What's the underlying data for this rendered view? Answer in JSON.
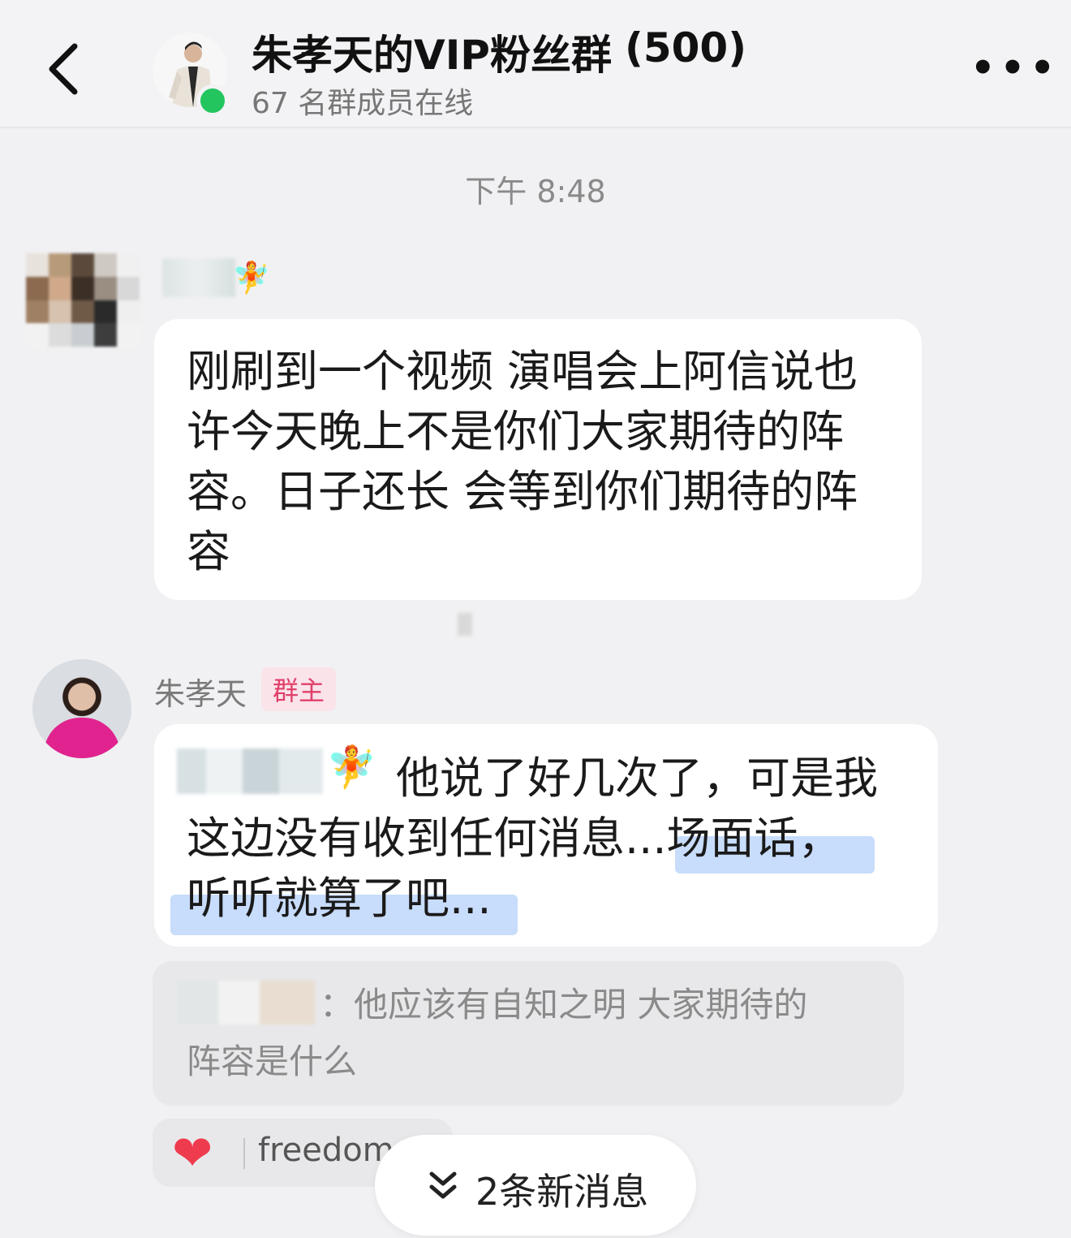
{
  "header": {
    "group_name": "朱孝天的VIP粉丝群",
    "member_count": "(500)",
    "online_status": "67 名群成员在线",
    "more_label": "•••"
  },
  "chat": {
    "timestamp": "下午 8:48",
    "messages": [
      {
        "sender_emoji": "🧚",
        "lines": [
          "刚刷到一个视频 演唱会上阿信说也",
          "许今天晚上不是你们大家期待的阵",
          "容。日子还长 会等到你们期待的阵",
          "容"
        ]
      },
      {
        "sender": "朱孝天",
        "badge": "群主",
        "mention_emoji": "🧚",
        "lines": [
          "他说了好几次了，可是我",
          "这边没有收到任何消息...场面话，",
          "听听就算了吧..."
        ],
        "quote": {
          "separator": "：",
          "lines": [
            "他应该有自知之明  大家期待的",
            "阵容是什么"
          ]
        },
        "reaction": {
          "icon": "heart-icon",
          "user": "freedom"
        }
      }
    ]
  },
  "new_messages": {
    "label": "2条新消息",
    "icon": "double-chevron-down-icon"
  },
  "colors": {
    "background": "#f1f1f3",
    "bubble": "#ffffff",
    "online": "#22c55e",
    "highlight": "#c8dcfb",
    "host_shirt": "#e0238f",
    "badge_text": "#e0406a"
  }
}
